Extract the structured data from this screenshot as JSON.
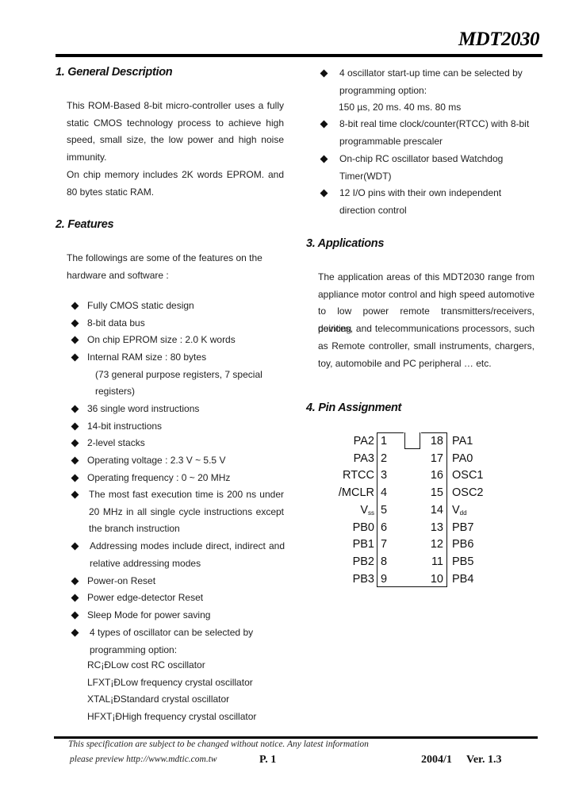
{
  "header": {
    "title": "MDT2030"
  },
  "sections": {
    "general": {
      "heading": "1. General Description",
      "lines": [
        "This ROM-Based 8-bit micro-controller uses a fully",
        "static CMOS technology process to achieve high",
        "speed, small size, the low power and high noise",
        "immunity.",
        "On chip memory includes 2K words EPROM. and",
        "80 bytes static RAM."
      ]
    },
    "features": {
      "heading": "2. Features",
      "intro": [
        "The followings are some of the features on the",
        "hardware and software :"
      ],
      "items": [
        {
          "lines": [
            "Fully CMOS static design"
          ]
        },
        {
          "lines": [
            "8-bit data bus"
          ]
        },
        {
          "lines": [
            "On chip EPROM size : 2.0 K words"
          ]
        },
        {
          "lines": [
            "Internal RAM size : 80 bytes",
            "(73 general purpose registers, 7 special",
            "registers)"
          ]
        },
        {
          "lines": [
            "36 single word instructions"
          ]
        },
        {
          "lines": [
            "14-bit instructions"
          ]
        },
        {
          "lines": [
            "2-level stacks"
          ]
        },
        {
          "lines": [
            "Operating voltage : 2.3 V ~ 5.5 V"
          ]
        },
        {
          "lines": [
            "Operating frequency : 0 ~ 20 MHz"
          ]
        },
        {
          "lines": [
            "The most fast execution time is 200 ns under",
            "20 MHz in all single cycle instructions except",
            "the branch instruction"
          ]
        },
        {
          "lines": [
            "Addressing modes include direct, indirect and",
            "relative addressing modes"
          ]
        },
        {
          "lines": [
            "Power-on Reset"
          ]
        },
        {
          "lines": [
            "Power edge-detector Reset"
          ]
        },
        {
          "lines": [
            "Sleep Mode for power saving"
          ]
        },
        {
          "lines": [
            "4 types of oscillator can be selected by",
            "programming option:"
          ]
        }
      ],
      "oscillator_types": [
        "RC¡ĐLow cost RC oscillator",
        "LFXT¡ĐLow frequency crystal oscillator",
        "XTAL¡ĐStandard crystal oscillator",
        "HFXT¡ĐHigh frequency crystal oscillator"
      ],
      "right_items": [
        {
          "lines": [
            "4 oscillator start-up time can be selected by",
            "programming option:",
            "150 µs, 20 ms. 40 ms. 80 ms"
          ]
        },
        {
          "lines": [
            "8-bit real time clock/counter(RTCC) with 8-bit",
            "programmable prescaler"
          ]
        },
        {
          "lines": [
            "On-chip RC oscillator based Watchdog",
            "Timer(WDT)"
          ]
        },
        {
          "lines": [
            "12 I/O pins with their own independent",
            "direction control"
          ]
        }
      ]
    },
    "applications": {
      "heading": "3. Applications",
      "lines": [
        "The application areas of this MDT2030 range from",
        "appliance motor control and high speed automotive",
        "to low power remote transmitters/receivers, pointing",
        "devices, and telecommunications processors, such",
        "as Remote controller, small instruments, chargers,",
        "toy, automobile and PC peripheral … etc."
      ]
    },
    "pins": {
      "heading": "4. Pin Assignment",
      "left": [
        {
          "num": "1",
          "name": "PA2"
        },
        {
          "num": "2",
          "name": "PA3"
        },
        {
          "num": "3",
          "name": "RTCC"
        },
        {
          "num": "4",
          "name": "/MCLR"
        },
        {
          "num": "5",
          "name": "V",
          "sub": "ss"
        },
        {
          "num": "6",
          "name": "PB0"
        },
        {
          "num": "7",
          "name": "PB1"
        },
        {
          "num": "8",
          "name": "PB2"
        },
        {
          "num": "9",
          "name": "PB3"
        }
      ],
      "right": [
        {
          "num": "18",
          "name": "PA1"
        },
        {
          "num": "17",
          "name": "PA0"
        },
        {
          "num": "16",
          "name": "OSC1"
        },
        {
          "num": "15",
          "name": "OSC2"
        },
        {
          "num": "14",
          "name": "V",
          "sub": "dd"
        },
        {
          "num": "13",
          "name": "PB7"
        },
        {
          "num": "12",
          "name": "PB6"
        },
        {
          "num": "11",
          "name": "PB5"
        },
        {
          "num": "10",
          "name": "PB4"
        }
      ]
    }
  },
  "footer": {
    "notice_line1": "This specification are subject to be changed without notice. Any latest information",
    "notice_line2": "please preview http://www.mdtic.com.tw",
    "page": "P. 1",
    "date": "2004/1",
    "version": "Ver. 1.3"
  }
}
